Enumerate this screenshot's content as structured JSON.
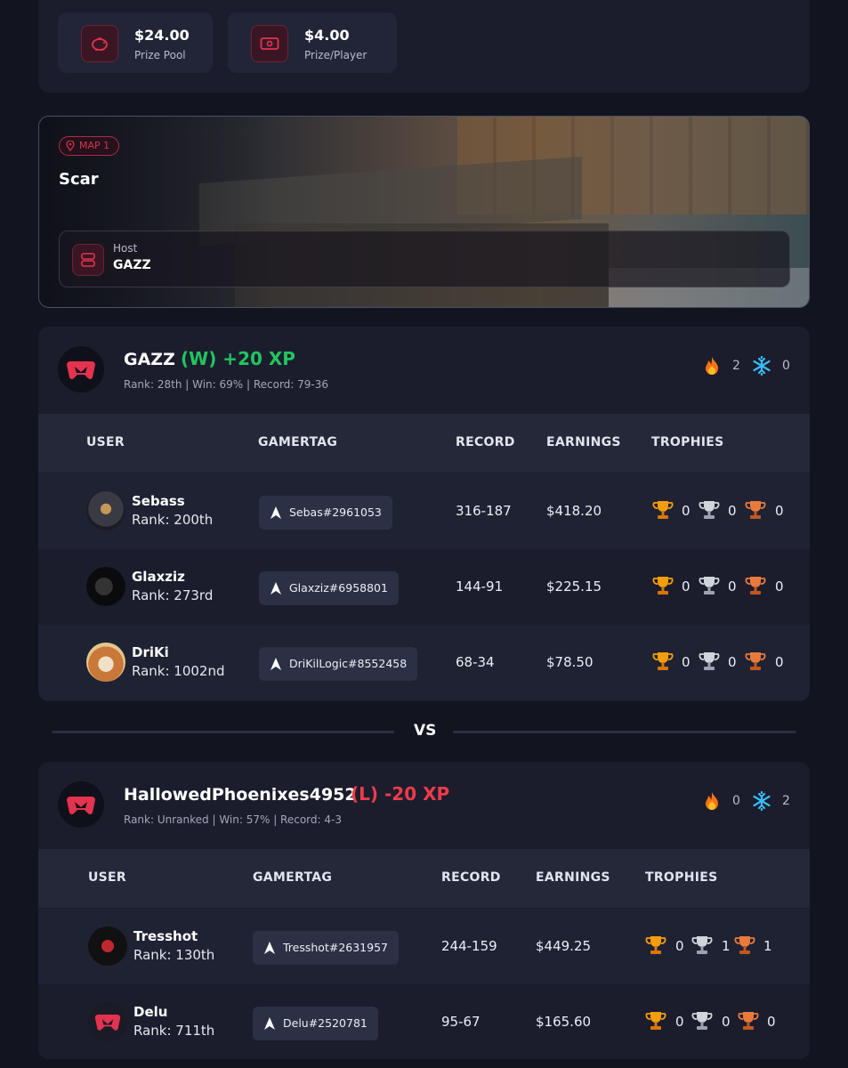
{
  "prize": {
    "pool_amount": "$24.00",
    "pool_label": "Prize Pool",
    "per_player_amount": "$4.00",
    "per_player_label": "Prize/Player"
  },
  "map": {
    "tag": "MAP 1",
    "name": "Scar",
    "host_label": "Host",
    "host_name": "GAZZ"
  },
  "vs": "VS",
  "teams": [
    {
      "name": "GAZZ",
      "result": "(W) +20 XP",
      "stats": "Rank: 28th | Win: 69% | Record: 79-36",
      "hot_streak": "2",
      "cold_streak": "0",
      "headers": [
        "USER",
        "GAMERTAG",
        "RECORD",
        "EARNINGS",
        "TROPHIES"
      ],
      "players": [
        {
          "name": "Sebass",
          "rank": "Rank: 200th",
          "gamertag": "Sebas#2961053",
          "record": "316-187",
          "earnings": "$418.20",
          "gold": "0",
          "silver": "0",
          "bronze": "0"
        },
        {
          "name": "Glaxziz",
          "rank": "Rank: 273rd",
          "gamertag": "Glaxziz#6958801",
          "record": "144-91",
          "earnings": "$225.15",
          "gold": "0",
          "silver": "0",
          "bronze": "0"
        },
        {
          "name": "DriKi",
          "rank": "Rank: 1002nd",
          "gamertag": "DriKilLogic#8552458",
          "record": "68-34",
          "earnings": "$78.50",
          "gold": "0",
          "silver": "0",
          "bronze": "0"
        }
      ]
    },
    {
      "name": "HallowedPhoenixes4952",
      "result": "(L) -20 XP",
      "stats": "Rank: Unranked | Win: 57% | Record: 4-3",
      "hot_streak": "0",
      "cold_streak": "2",
      "headers": [
        "USER",
        "GAMERTAG",
        "RECORD",
        "EARNINGS",
        "TROPHIES"
      ],
      "players": [
        {
          "name": "Tresshot",
          "rank": "Rank: 130th",
          "gamertag": "Tresshot#2631957",
          "record": "244-159",
          "earnings": "$449.25",
          "gold": "0",
          "silver": "1",
          "bronze": "1"
        },
        {
          "name": "Delu",
          "rank": "Rank: 711th",
          "gamertag": "Delu#2520781",
          "record": "95-67",
          "earnings": "$165.60",
          "gold": "0",
          "silver": "0",
          "bronze": "0"
        }
      ]
    }
  ],
  "colors": {
    "accent": "#e3334f",
    "win": "#22c55e",
    "loss": "#ef3b4a",
    "card": "#1b1d2d",
    "background": "#121420"
  },
  "icons": {
    "prize_pool": "piggy-bank-icon",
    "prize_player": "cash-icon",
    "map": "location-pin-icon",
    "host": "server-icon",
    "hot": "fire-icon",
    "cold": "snowflake-icon",
    "gamertag": "activision-icon",
    "trophies": [
      "gold-trophy-icon",
      "silver-trophy-icon",
      "bronze-trophy-icon"
    ]
  }
}
